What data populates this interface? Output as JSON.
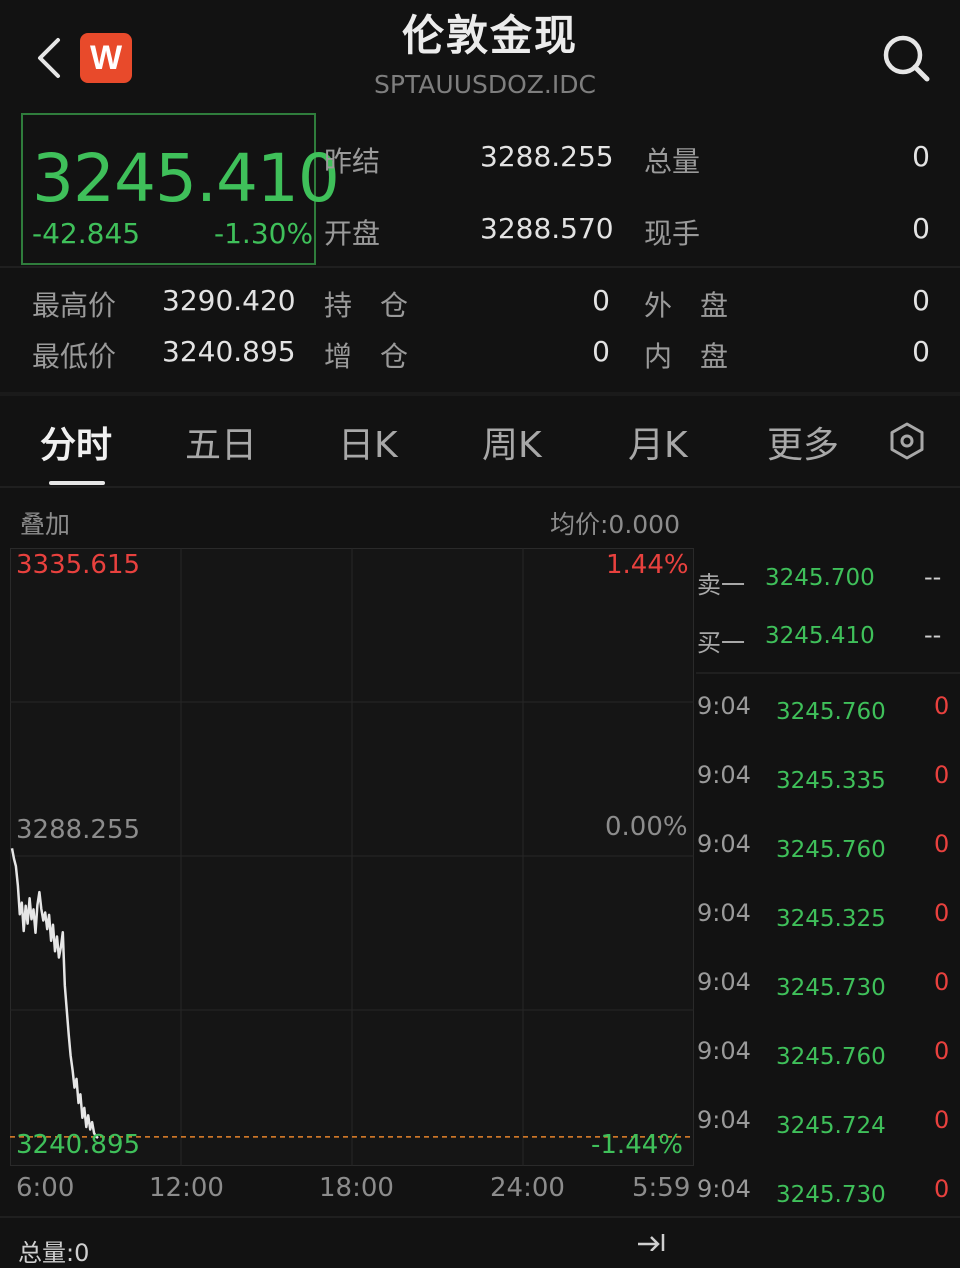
{
  "header": {
    "title": "伦敦金现",
    "code": "SPTAUUSDOZ.IDC",
    "logo_letter": "W"
  },
  "quote": {
    "price": "3245.410",
    "change": "-42.845",
    "change_pct": "-1.30%",
    "prev_close_label": "昨结",
    "prev_close": "3288.255",
    "open_label": "开盘",
    "open": "3288.570",
    "volume_label": "总量",
    "volume": "0",
    "current_hand_label": "现手",
    "current_hand": "0",
    "high_label": "最高价",
    "high": "3290.420",
    "low_label": "最低价",
    "low": "3240.895",
    "open_interest_label": "持　仓",
    "open_interest": "0",
    "incr_label": "增　仓",
    "incr": "0",
    "outer_label": "外　盘",
    "outer": "0",
    "inner_label": "内　盘",
    "inner": "0"
  },
  "tabs": [
    {
      "label": "分时",
      "active": true
    },
    {
      "label": "五日",
      "active": false
    },
    {
      "label": "日K",
      "active": false
    },
    {
      "label": "周K",
      "active": false
    },
    {
      "label": "月K",
      "active": false
    },
    {
      "label": "更多",
      "active": false
    }
  ],
  "chart_toolbar": {
    "overlay_label": "叠加",
    "avg_price_label": "均价:0.000"
  },
  "chart_data": {
    "type": "line",
    "y_max_label": "3335.615",
    "y_mid_label": "3288.255",
    "y_min_label": "3240.895",
    "pct_max_label": "1.44%",
    "pct_mid_label": "0.00%",
    "pct_min_label": "-1.44%",
    "ylim": [
      3240.895,
      3335.615
    ],
    "x_tick_labels": [
      "6:00",
      "12:00",
      "18:00",
      "24:00",
      "5:59"
    ],
    "x": [
      0,
      1,
      2,
      3,
      4,
      5,
      6,
      7,
      8,
      9,
      10,
      11,
      12,
      13,
      14,
      15,
      16,
      17,
      18,
      19,
      20,
      21,
      22,
      23,
      24,
      25,
      26,
      27,
      28,
      29,
      30,
      31,
      32,
      33,
      34,
      35,
      36,
      37,
      38,
      39,
      40,
      41,
      42,
      43,
      44
    ],
    "series": [
      {
        "values": [
          3288.2,
          3286.5,
          3285.3,
          3282.1,
          3277.5,
          3279.4,
          3274.8,
          3278.9,
          3276.0,
          3280.1,
          3276.7,
          3278.3,
          3274.5,
          3279.0,
          3281.1,
          3278.4,
          3276.5,
          3277.8,
          3275.1,
          3277.4,
          3273.2,
          3275.8,
          3271.5,
          3273.9,
          3270.5,
          3272.2,
          3274.6,
          3266.0,
          3262.1,
          3258.0,
          3254.6,
          3252.2,
          3249.4,
          3250.8,
          3246.9,
          3248.3,
          3244.5,
          3246.1,
          3243.0,
          3244.9,
          3242.6,
          3243.8,
          3242.0,
          3241.5,
          3241.2
        ],
        "color": "#e6e6e6"
      }
    ],
    "prev_close_line": 3288.255,
    "last_line": 3241.4
  },
  "order_book": {
    "sell_label": "卖一",
    "sell_price": "3245.700",
    "sell_vol": "--",
    "buy_label": "买一",
    "buy_price": "3245.410",
    "buy_vol": "--"
  },
  "ticks": [
    {
      "time": "9:04",
      "price": "3245.760",
      "vol": "0"
    },
    {
      "time": "9:04",
      "price": "3245.335",
      "vol": "0"
    },
    {
      "time": "9:04",
      "price": "3245.760",
      "vol": "0"
    },
    {
      "time": "9:04",
      "price": "3245.325",
      "vol": "0"
    },
    {
      "time": "9:04",
      "price": "3245.730",
      "vol": "0"
    },
    {
      "time": "9:04",
      "price": "3245.760",
      "vol": "0"
    },
    {
      "time": "9:04",
      "price": "3245.724",
      "vol": "0"
    },
    {
      "time": "9:04",
      "price": "3245.730",
      "vol": "0"
    }
  ],
  "footer": {
    "volume_text": "总量:0"
  }
}
